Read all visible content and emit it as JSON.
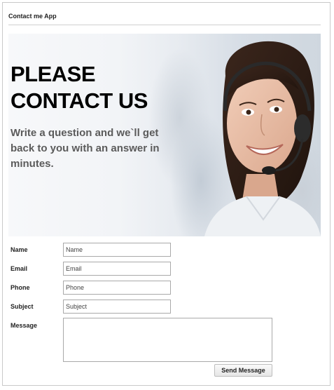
{
  "app": {
    "title": "Contact me App"
  },
  "hero": {
    "heading": "PLEASE CONTACT US",
    "subheading": "Write a question and we`ll get back to you with an answer in minutes."
  },
  "form": {
    "name": {
      "label": "Name",
      "placeholder": "Name",
      "value": ""
    },
    "email": {
      "label": "Email",
      "placeholder": "Email",
      "value": ""
    },
    "phone": {
      "label": "Phone",
      "placeholder": "Phone",
      "value": ""
    },
    "subject": {
      "label": "Subject",
      "placeholder": "Subject",
      "value": ""
    },
    "message": {
      "label": "Message",
      "placeholder": "",
      "value": ""
    },
    "send_label": "Send Message"
  },
  "icons": [
    "headset-icon"
  ]
}
